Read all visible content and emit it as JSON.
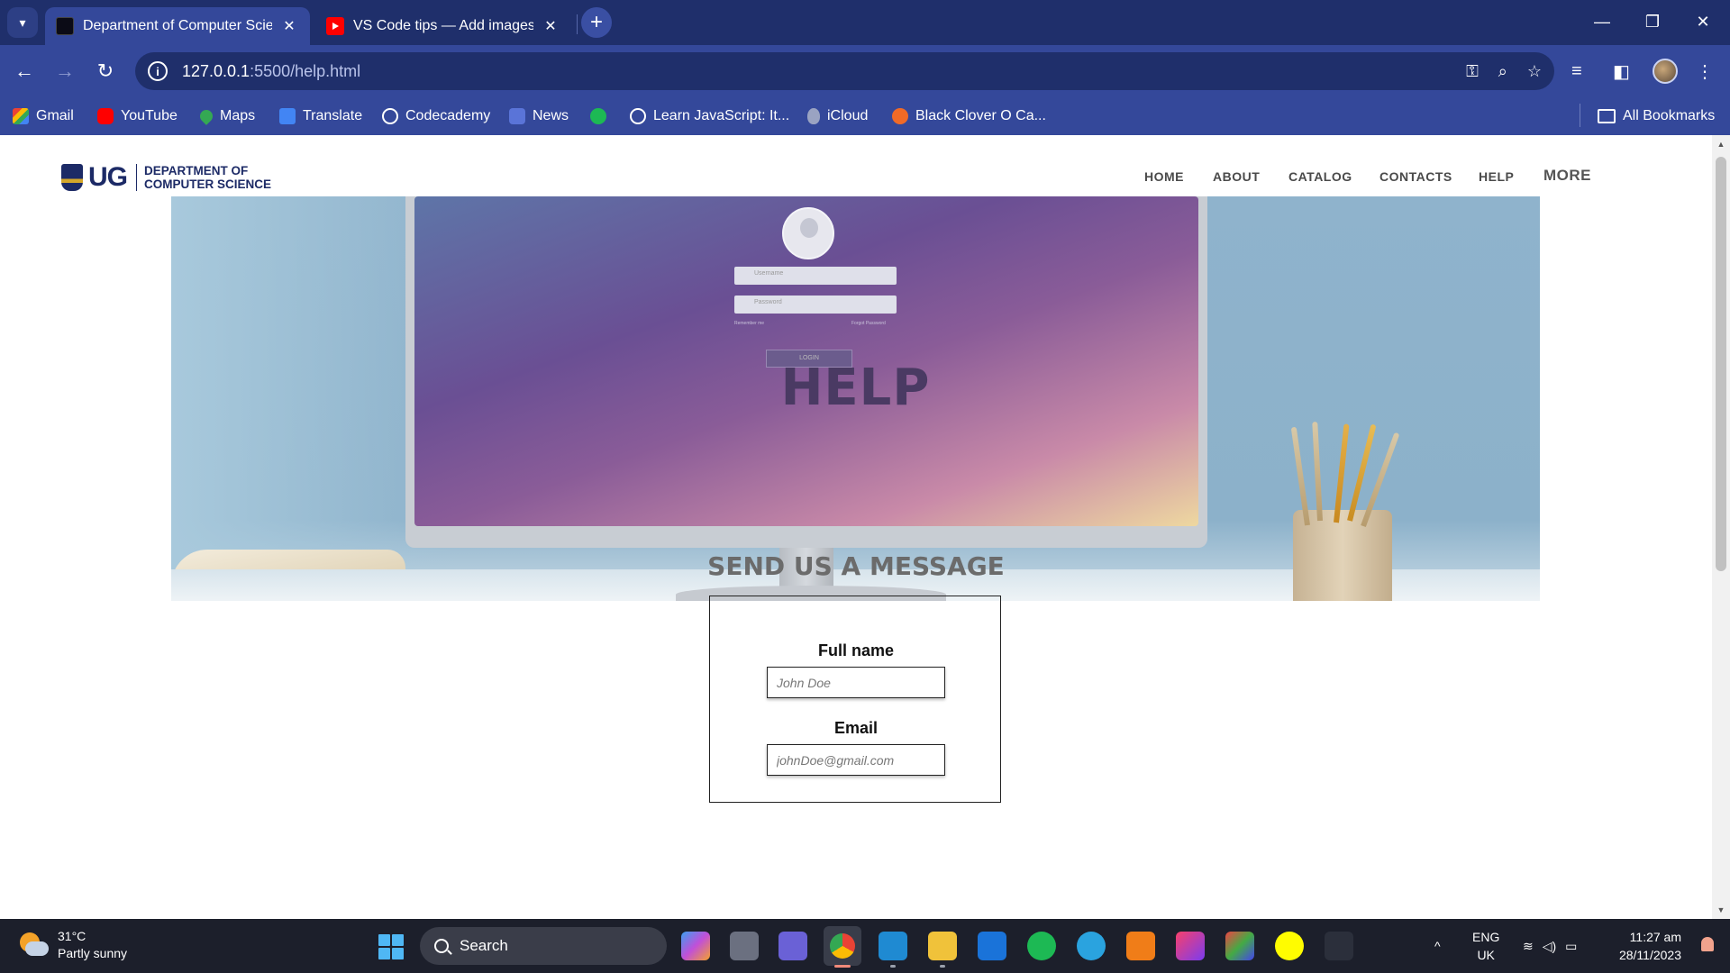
{
  "browser": {
    "tabs": [
      {
        "title": "Department of Computer Scien",
        "active": true,
        "icon": "department-favicon"
      },
      {
        "title": "VS Code tips — Add images an",
        "active": false,
        "icon": "youtube-favicon"
      }
    ],
    "address": {
      "host": "127.0.0.1",
      "path": ":5500/help.html"
    },
    "bookmarks": [
      {
        "label": "Gmail",
        "icon": "gmail-icon"
      },
      {
        "label": "YouTube",
        "icon": "youtube-icon"
      },
      {
        "label": "Maps",
        "icon": "maps-icon"
      },
      {
        "label": "Translate",
        "icon": "translate-icon"
      },
      {
        "label": "Codecademy",
        "icon": "globe-icon"
      },
      {
        "label": "News",
        "icon": "news-icon"
      },
      {
        "label": "",
        "icon": "spotify-icon"
      },
      {
        "label": "Learn JavaScript: It...",
        "icon": "globe-icon"
      },
      {
        "label": "iCloud",
        "icon": "apple-icon"
      },
      {
        "label": "Black Clover O Ca...",
        "icon": "crunchyroll-icon"
      }
    ],
    "all_bookmarks": "All Bookmarks"
  },
  "site": {
    "logo": {
      "mark": "UG",
      "line1": "DEPARTMENT OF",
      "line2": "COMPUTER SCIENCE"
    },
    "nav": [
      "HOME",
      "ABOUT",
      "CATALOG",
      "CONTACTS",
      "HELP",
      "MORE"
    ],
    "hero_title": "HELP",
    "hero_mock": {
      "username": "Username",
      "password": "Password",
      "remember": "Remember me",
      "forgot": "Forgot Password",
      "login": "LOGIN"
    },
    "form": {
      "title": "SEND US A MESSAGE",
      "fullname_label": "Full name",
      "fullname_placeholder": "John Doe",
      "email_label": "Email",
      "email_placeholder": "johnDoe@gmail.com"
    }
  },
  "taskbar": {
    "weather": {
      "temp": "31°C",
      "condition": "Partly sunny"
    },
    "search_label": "Search",
    "language": {
      "line1": "ENG",
      "line2": "UK"
    },
    "time": "11:27 am",
    "date": "28/11/2023"
  },
  "colors": {
    "chrome_dark": "#1f2f6b",
    "chrome": "#34489a",
    "brand_navy": "#1c2a66",
    "taskbar": "#1c1f2b"
  }
}
